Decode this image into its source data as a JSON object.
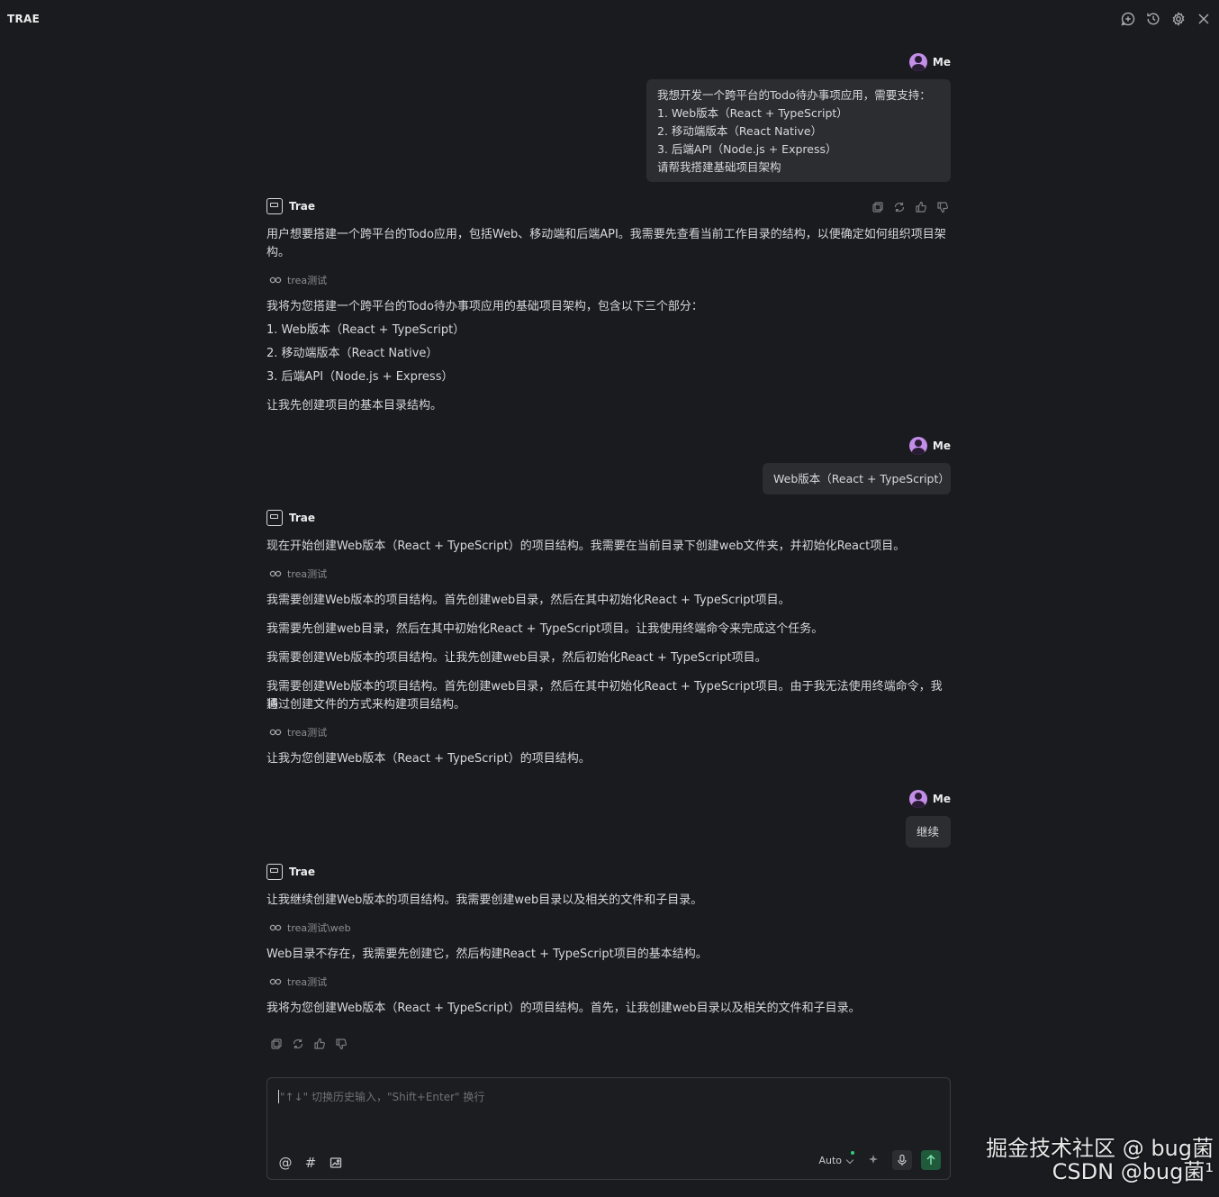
{
  "header": {
    "title": "TRAE",
    "icons": [
      "new-chat-icon",
      "history-icon",
      "settings-icon",
      "close-icon"
    ]
  },
  "messages": {
    "user1": {
      "name": "Me",
      "text": "我想开发一个跨平台的Todo待办事项应用，需要支持：\n1. Web版本（React + TypeScript）\n2. 移动端版本（React Native）\n3. 后端API（Node.js + Express）\n请帮我搭建基础项目架构"
    },
    "ai1": {
      "name": "Trae",
      "p1": "用户想要搭建一个跨平台的Todo应用，包括Web、移动端和后端API。我需要先查看当前工作目录的结构，以便确定如何组织项目架",
      "p1b": "构。",
      "tool1": "trea测试",
      "p2": "我将为您搭建一个跨平台的Todo待办事项应用的基础项目架构，包含以下三个部分：",
      "l1": "1. Web版本（React + TypeScript）",
      "l2": "2. 移动端版本（React Native）",
      "l3": "3. 后端API（Node.js + Express）",
      "p3": "让我先创建项目的基本目录结构。"
    },
    "user2": {
      "name": "Me",
      "text": "Web版本（React + TypeScript）"
    },
    "ai2": {
      "name": "Trae",
      "p1": "现在开始创建Web版本（React + TypeScript）的项目结构。我需要在当前目录下创建web文件夹，并初始化React项目。",
      "tool1": "trea测试",
      "p2": "我需要创建Web版本的项目结构。首先创建web目录，然后在其中初始化React + TypeScript项目。",
      "p3": "我需要先创建web目录，然后在其中初始化React + TypeScript项目。让我使用终端命令来完成这个任务。",
      "p4": "我需要创建Web版本的项目结构。让我先创建web目录，然后初始化React + TypeScript项目。",
      "p5": "我需要创建Web版本的项目结构。首先创建web目录，然后在其中初始化React + TypeScript项目。由于我无法使用终端命令，我将",
      "p5b": "通过创建文件的方式来构建项目结构。",
      "tool2": "trea测试",
      "p6": "让我为您创建Web版本（React + TypeScript）的项目结构。"
    },
    "user3": {
      "name": "Me",
      "text": "继续"
    },
    "ai3": {
      "name": "Trae",
      "p1": "让我继续创建Web版本的项目结构。我需要创建web目录以及相关的文件和子目录。",
      "tool1": "trea测试\\web",
      "p2": "Web目录不存在，我需要先创建它，然后构建React + TypeScript项目的基本结构。",
      "tool2": "trea测试",
      "p3": "我将为您创建Web版本（React + TypeScript）的项目结构。首先，让我创建web目录以及相关的文件和子目录。"
    }
  },
  "composer": {
    "placeholder": "\"↑↓\" 切换历史输入，\"Shift+Enter\" 换行",
    "mode": "Auto",
    "mention": "@",
    "hash": "#"
  },
  "watermark": {
    "line1": "掘金技术社区 @ bug菌",
    "line2": "CSDN @bug菌¹"
  }
}
